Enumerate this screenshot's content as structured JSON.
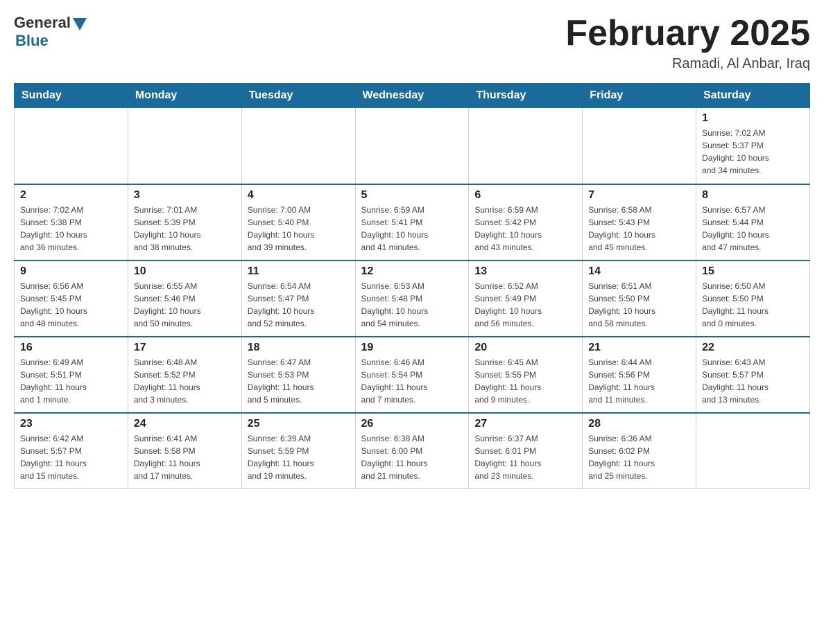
{
  "header": {
    "logo_general": "General",
    "logo_blue": "Blue",
    "month_title": "February 2025",
    "location": "Ramadi, Al Anbar, Iraq"
  },
  "days_of_week": [
    "Sunday",
    "Monday",
    "Tuesday",
    "Wednesday",
    "Thursday",
    "Friday",
    "Saturday"
  ],
  "weeks": [
    {
      "days": [
        {
          "num": "",
          "info": ""
        },
        {
          "num": "",
          "info": ""
        },
        {
          "num": "",
          "info": ""
        },
        {
          "num": "",
          "info": ""
        },
        {
          "num": "",
          "info": ""
        },
        {
          "num": "",
          "info": ""
        },
        {
          "num": "1",
          "info": "Sunrise: 7:02 AM\nSunset: 5:37 PM\nDaylight: 10 hours\nand 34 minutes."
        }
      ]
    },
    {
      "days": [
        {
          "num": "2",
          "info": "Sunrise: 7:02 AM\nSunset: 5:38 PM\nDaylight: 10 hours\nand 36 minutes."
        },
        {
          "num": "3",
          "info": "Sunrise: 7:01 AM\nSunset: 5:39 PM\nDaylight: 10 hours\nand 38 minutes."
        },
        {
          "num": "4",
          "info": "Sunrise: 7:00 AM\nSunset: 5:40 PM\nDaylight: 10 hours\nand 39 minutes."
        },
        {
          "num": "5",
          "info": "Sunrise: 6:59 AM\nSunset: 5:41 PM\nDaylight: 10 hours\nand 41 minutes."
        },
        {
          "num": "6",
          "info": "Sunrise: 6:59 AM\nSunset: 5:42 PM\nDaylight: 10 hours\nand 43 minutes."
        },
        {
          "num": "7",
          "info": "Sunrise: 6:58 AM\nSunset: 5:43 PM\nDaylight: 10 hours\nand 45 minutes."
        },
        {
          "num": "8",
          "info": "Sunrise: 6:57 AM\nSunset: 5:44 PM\nDaylight: 10 hours\nand 47 minutes."
        }
      ]
    },
    {
      "days": [
        {
          "num": "9",
          "info": "Sunrise: 6:56 AM\nSunset: 5:45 PM\nDaylight: 10 hours\nand 48 minutes."
        },
        {
          "num": "10",
          "info": "Sunrise: 6:55 AM\nSunset: 5:46 PM\nDaylight: 10 hours\nand 50 minutes."
        },
        {
          "num": "11",
          "info": "Sunrise: 6:54 AM\nSunset: 5:47 PM\nDaylight: 10 hours\nand 52 minutes."
        },
        {
          "num": "12",
          "info": "Sunrise: 6:53 AM\nSunset: 5:48 PM\nDaylight: 10 hours\nand 54 minutes."
        },
        {
          "num": "13",
          "info": "Sunrise: 6:52 AM\nSunset: 5:49 PM\nDaylight: 10 hours\nand 56 minutes."
        },
        {
          "num": "14",
          "info": "Sunrise: 6:51 AM\nSunset: 5:50 PM\nDaylight: 10 hours\nand 58 minutes."
        },
        {
          "num": "15",
          "info": "Sunrise: 6:50 AM\nSunset: 5:50 PM\nDaylight: 11 hours\nand 0 minutes."
        }
      ]
    },
    {
      "days": [
        {
          "num": "16",
          "info": "Sunrise: 6:49 AM\nSunset: 5:51 PM\nDaylight: 11 hours\nand 1 minute."
        },
        {
          "num": "17",
          "info": "Sunrise: 6:48 AM\nSunset: 5:52 PM\nDaylight: 11 hours\nand 3 minutes."
        },
        {
          "num": "18",
          "info": "Sunrise: 6:47 AM\nSunset: 5:53 PM\nDaylight: 11 hours\nand 5 minutes."
        },
        {
          "num": "19",
          "info": "Sunrise: 6:46 AM\nSunset: 5:54 PM\nDaylight: 11 hours\nand 7 minutes."
        },
        {
          "num": "20",
          "info": "Sunrise: 6:45 AM\nSunset: 5:55 PM\nDaylight: 11 hours\nand 9 minutes."
        },
        {
          "num": "21",
          "info": "Sunrise: 6:44 AM\nSunset: 5:56 PM\nDaylight: 11 hours\nand 11 minutes."
        },
        {
          "num": "22",
          "info": "Sunrise: 6:43 AM\nSunset: 5:57 PM\nDaylight: 11 hours\nand 13 minutes."
        }
      ]
    },
    {
      "days": [
        {
          "num": "23",
          "info": "Sunrise: 6:42 AM\nSunset: 5:57 PM\nDaylight: 11 hours\nand 15 minutes."
        },
        {
          "num": "24",
          "info": "Sunrise: 6:41 AM\nSunset: 5:58 PM\nDaylight: 11 hours\nand 17 minutes."
        },
        {
          "num": "25",
          "info": "Sunrise: 6:39 AM\nSunset: 5:59 PM\nDaylight: 11 hours\nand 19 minutes."
        },
        {
          "num": "26",
          "info": "Sunrise: 6:38 AM\nSunset: 6:00 PM\nDaylight: 11 hours\nand 21 minutes."
        },
        {
          "num": "27",
          "info": "Sunrise: 6:37 AM\nSunset: 6:01 PM\nDaylight: 11 hours\nand 23 minutes."
        },
        {
          "num": "28",
          "info": "Sunrise: 6:36 AM\nSunset: 6:02 PM\nDaylight: 11 hours\nand 25 minutes."
        },
        {
          "num": "",
          "info": ""
        }
      ]
    }
  ]
}
